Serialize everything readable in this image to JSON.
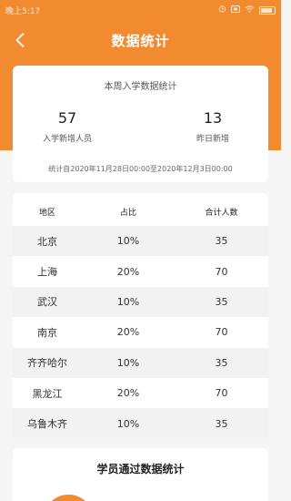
{
  "status_bar": {
    "time": "晚上5:17"
  },
  "header": {
    "title": "数据统计"
  },
  "summary": {
    "title": "本周入学数据统计",
    "new_students_value": "57",
    "new_students_label": "入学新增人员",
    "yesterday_value": "13",
    "yesterday_label": "昨日新增",
    "range_text": "统计自2020年11月28日00:00至2020年12月3日00:00"
  },
  "table": {
    "headers": [
      "地区",
      "占比",
      "合计人数"
    ],
    "rows": [
      [
        "北京",
        "10%",
        "35"
      ],
      [
        "上海",
        "20%",
        "70"
      ],
      [
        "武汉",
        "10%",
        "35"
      ],
      [
        "南京",
        "20%",
        "70"
      ],
      [
        "齐齐哈尔",
        "10%",
        "35"
      ],
      [
        "黑龙江",
        "20%",
        "70"
      ],
      [
        "乌鲁木齐",
        "10%",
        "35"
      ]
    ]
  },
  "pass_stats": {
    "title": "学员通过数据统计"
  },
  "colors": {
    "accent": "#f28a30",
    "row_shade": "#f2f2f2"
  },
  "icons": [
    "back-arrow-icon",
    "alarm-icon",
    "sim-icon",
    "wifi-icon",
    "battery-icon"
  ]
}
